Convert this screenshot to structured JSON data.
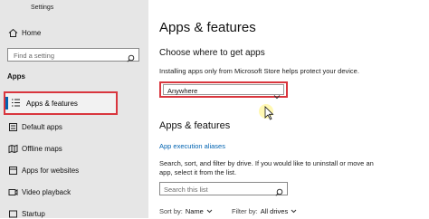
{
  "window": {
    "title": "Settings"
  },
  "sidebar": {
    "home": "Home",
    "search_placeholder": "Find a setting",
    "section": "Apps",
    "items": [
      {
        "label": "Apps & features",
        "icon": "list-icon",
        "selected": true
      },
      {
        "label": "Default apps",
        "icon": "default-apps-icon"
      },
      {
        "label": "Offline maps",
        "icon": "map-icon"
      },
      {
        "label": "Apps for websites",
        "icon": "apps-websites-icon"
      },
      {
        "label": "Video playback",
        "icon": "video-icon"
      },
      {
        "label": "Startup",
        "icon": "startup-icon"
      }
    ]
  },
  "main": {
    "title": "Apps & features",
    "choose_heading": "Choose where to get apps",
    "install_note": "Installing apps only from Microsoft Store helps protect your device.",
    "dropdown_value": "Anywhere",
    "apps_heading": "Apps & features",
    "exec_alias_link": "App execution aliases",
    "description": "Search, sort, and filter by drive. If you would like to uninstall or move an app, select it from the list.",
    "search_list_placeholder": "Search this list",
    "sort_label": "Sort by:",
    "sort_value": "Name",
    "filter_label": "Filter by:",
    "filter_value": "All drives"
  },
  "colors": {
    "accent": "#0063b1",
    "highlight_border": "#d9363e",
    "sidebar_bg": "#e6e6e6"
  }
}
